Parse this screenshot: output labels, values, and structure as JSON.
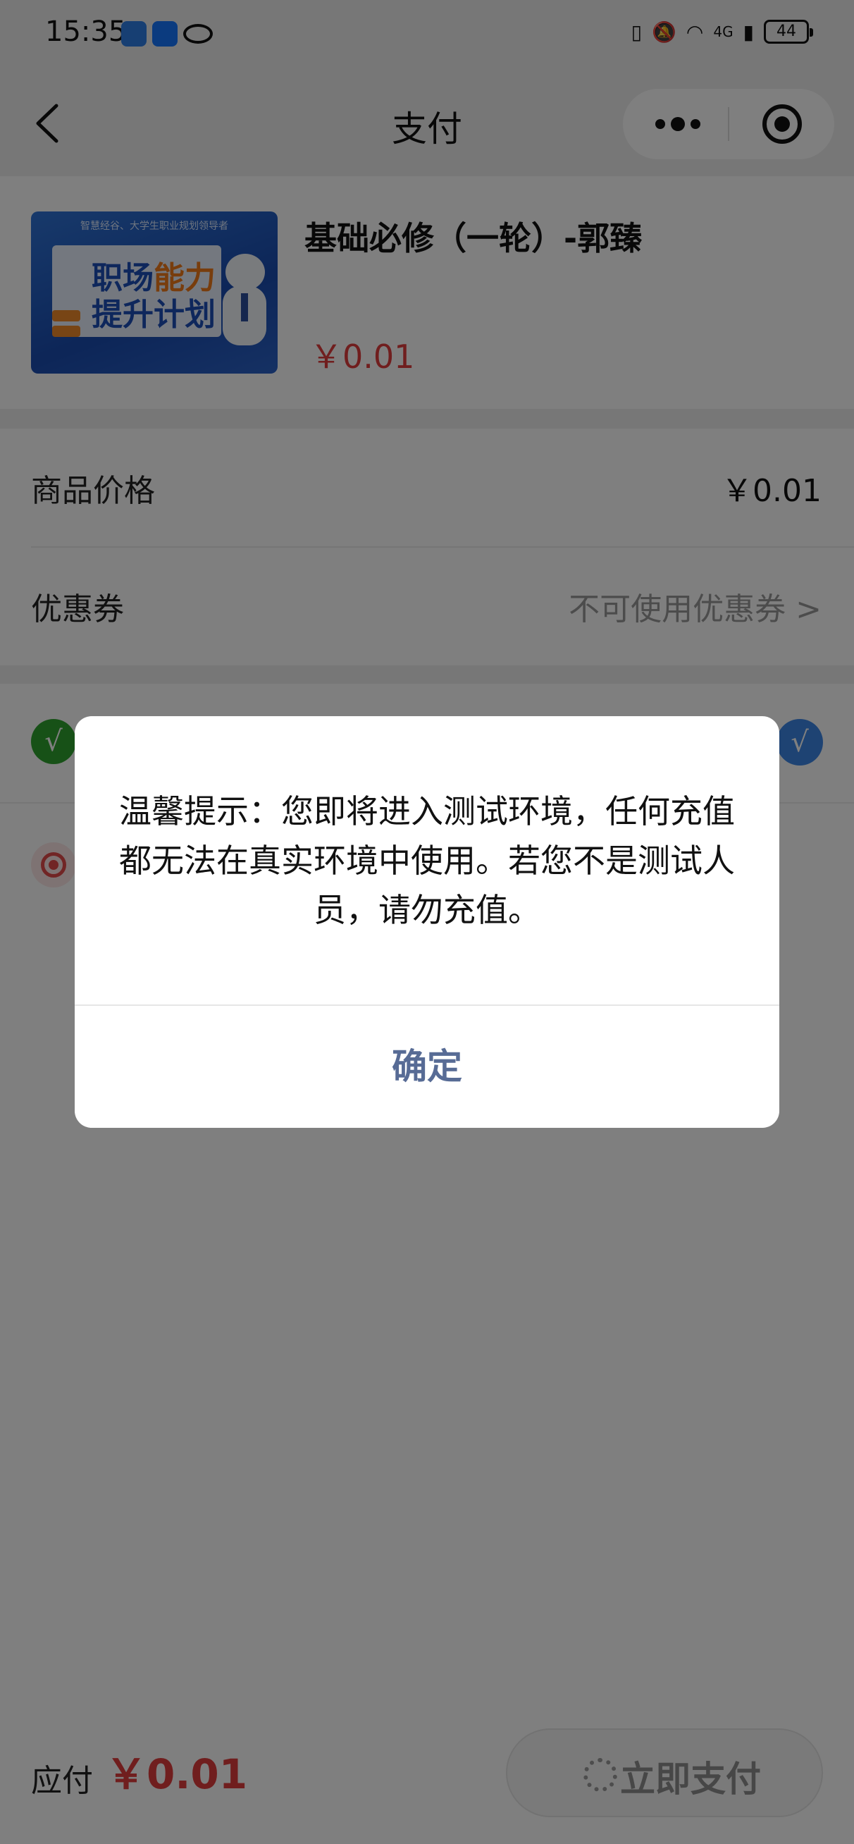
{
  "status_bar": {
    "time": "15:35",
    "network": "4G",
    "battery": "44"
  },
  "nav": {
    "title": "支付"
  },
  "product": {
    "title": "基础必修（一轮）-郭臻",
    "price": "￥0.01",
    "thumb_top": "智慧经谷、大学生职业规划领导者",
    "thumb_line1_a": "职场",
    "thumb_line1_b": "能力",
    "thumb_line2": "提升计划"
  },
  "rows": {
    "price_label": "商品价格",
    "price_value": "￥0.01",
    "coupon_label": "优惠券",
    "coupon_value": "不可使用优惠券 >"
  },
  "payment": {
    "wechat_mark": "√",
    "selected_mark": "√"
  },
  "footer": {
    "due_label": "应付",
    "due_value": "￥0.01",
    "pay_button": "立即支付"
  },
  "modal": {
    "message": "温馨提示：您即将进入测试环境，任何充值都无法在真实环境中使用。若您不是测试人员，请勿充值。",
    "confirm": "确定"
  },
  "colors": {
    "accent_red": "#e03d3d",
    "dialog_link": "#576b95",
    "wechat_green": "#2fa22f",
    "select_blue": "#3d86e6"
  }
}
